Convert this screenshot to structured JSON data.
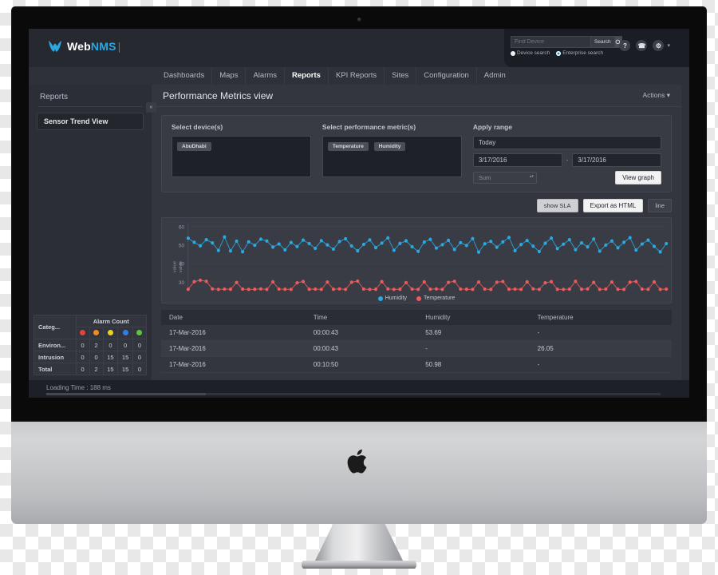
{
  "brand": {
    "web": "Web",
    "nms": "NMS",
    "bar": "|"
  },
  "search": {
    "placeholder": "Find Device",
    "button": "Search",
    "icon": "search-icon",
    "options": [
      {
        "label": "Device search",
        "selected": false
      },
      {
        "label": "Enterprise search",
        "selected": true
      }
    ]
  },
  "header_icons": [
    {
      "name": "help-icon",
      "glyph": "?"
    },
    {
      "name": "phone-icon",
      "glyph": "☎"
    },
    {
      "name": "gear-icon",
      "glyph": "⚙"
    }
  ],
  "nav": {
    "items": [
      {
        "label": "Dashboards",
        "active": false
      },
      {
        "label": "Maps",
        "active": false
      },
      {
        "label": "Alarms",
        "active": false
      },
      {
        "label": "Reports",
        "active": true
      },
      {
        "label": "KPI Reports",
        "active": false
      },
      {
        "label": "Sites",
        "active": false
      },
      {
        "label": "Configuration",
        "active": false
      },
      {
        "label": "Admin",
        "active": false
      }
    ]
  },
  "sidebar": {
    "title": "Reports",
    "collapse_glyph": "«",
    "items": [
      {
        "label": "Sensor Trend View",
        "active": true
      }
    ]
  },
  "alarm_table": {
    "category_header": "Categ...",
    "count_header": "Alarm Count",
    "severity_colors": [
      "#e8413a",
      "#ef8b1f",
      "#e8d321",
      "#2f7fe8",
      "#5cc63c"
    ],
    "rows": [
      {
        "label": "Environ...",
        "values": [
          "0",
          "2",
          "0",
          "0",
          "0"
        ]
      },
      {
        "label": "Intrusion",
        "values": [
          "0",
          "0",
          "15",
          "15",
          "0"
        ]
      },
      {
        "label": "Total",
        "values": [
          "0",
          "2",
          "15",
          "15",
          "0"
        ]
      }
    ]
  },
  "page": {
    "title": "Performance Metrics view",
    "actions": "Actions"
  },
  "form": {
    "device_label": "Select device(s)",
    "device_tags": [
      "AbuDhabi"
    ],
    "metric_label": "Select performance metric(s)",
    "metric_tags": [
      "Temperature",
      "Humidity"
    ],
    "range_label": "Apply range",
    "range_value": "Today",
    "date_from": "3/17/2016",
    "date_to": "3/17/2016",
    "date_sep": "-",
    "aggregate": "Sum",
    "view_graph": "View graph"
  },
  "toolbar": {
    "show_sla": "show SLA",
    "export_html": "Export as HTML",
    "chart_type": "line"
  },
  "chart_data": {
    "type": "line",
    "title": "",
    "xlabel": "",
    "ylabel": "value",
    "ylim": [
      25,
      62
    ],
    "yticks": [
      30,
      40,
      50,
      60
    ],
    "grid": true,
    "legend_position": "bottom",
    "series": [
      {
        "name": "Humidity",
        "color": "#29abe2",
        "values": [
          53.7,
          51.5,
          49.6,
          52.9,
          51.2,
          47.1,
          54.4,
          46.8,
          52.1,
          46.4,
          51.8,
          49.9,
          53.2,
          52.2,
          48.9,
          50.6,
          47.4,
          51.4,
          49.2,
          52.7,
          50.8,
          48.2,
          52.4,
          50.1,
          47.8,
          51.9,
          53.4,
          49.5,
          46.9,
          50.4,
          52.8,
          48.6,
          51.1,
          53.9,
          47.2,
          50.9,
          52.3,
          49.1,
          46.6,
          51.6,
          53.1,
          48.4,
          50.2,
          52.6,
          47.6,
          51.3,
          49.8,
          53.5,
          46.2,
          50.7,
          52.0,
          48.8,
          51.7,
          54.1,
          47.0,
          50.3,
          52.5,
          49.4,
          46.5,
          51.0,
          53.8,
          48.1,
          50.5,
          52.9,
          47.5,
          51.2,
          49.0,
          53.3,
          46.7,
          50.0,
          52.2,
          48.5,
          51.5,
          54.0,
          47.3,
          50.6,
          52.7,
          49.3,
          46.3,
          50.8
        ]
      },
      {
        "name": "Temperature",
        "color": "#ef5b5b",
        "values": [
          26.1,
          30.2,
          31.0,
          30.4,
          26.3,
          26.0,
          26.2,
          26.1,
          29.8,
          26.2,
          26.0,
          26.1,
          26.3,
          26.0,
          30.1,
          26.2,
          26.1,
          26.0,
          29.6,
          30.3,
          26.1,
          26.2,
          26.0,
          30.0,
          26.1,
          26.3,
          26.0,
          29.9,
          30.5,
          26.2,
          26.0,
          26.1,
          30.2,
          26.3,
          26.0,
          26.1,
          29.7,
          26.2,
          26.0,
          30.1,
          26.1,
          26.3,
          26.0,
          29.8,
          30.4,
          26.2,
          26.1,
          26.0,
          30.0,
          26.2,
          26.0,
          29.9,
          30.3,
          26.1,
          26.2,
          26.0,
          30.1,
          26.3,
          26.0,
          29.6,
          30.2,
          26.1,
          26.0,
          26.2,
          30.4,
          26.1,
          26.3,
          29.8,
          26.0,
          26.2,
          30.0,
          26.1,
          26.0,
          29.9,
          30.3,
          26.2,
          26.1,
          30.1,
          26.0,
          26.2
        ]
      }
    ]
  },
  "data_table": {
    "columns": [
      "Date",
      "Time",
      "Humidity",
      "Temperature"
    ],
    "rows": [
      {
        "date": "17-Mar-2016",
        "time": "00:00:43",
        "humidity": "53.69",
        "temperature": "-"
      },
      {
        "date": "17-Mar-2016",
        "time": "00:00:43",
        "humidity": "-",
        "temperature": "26.05"
      },
      {
        "date": "17-Mar-2016",
        "time": "00:10:50",
        "humidity": "50.98",
        "temperature": "-"
      }
    ]
  },
  "status": {
    "loading_time": "Loading Time : 188 ms"
  }
}
